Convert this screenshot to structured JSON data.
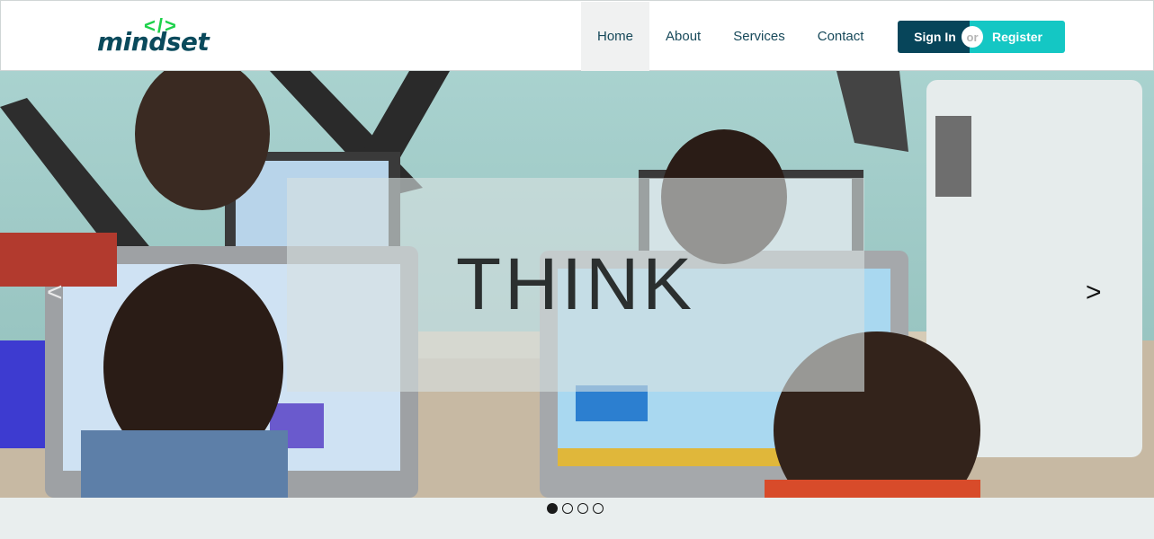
{
  "header": {
    "logo": {
      "code": "</>",
      "text": "mindset",
      "code_color": "#1dd14a",
      "text_color": "#0a4a5c"
    },
    "nav": [
      {
        "label": "Home",
        "active": true
      },
      {
        "label": "About",
        "active": false
      },
      {
        "label": "Services",
        "active": false
      },
      {
        "label": "Contact",
        "active": false
      }
    ],
    "auth": {
      "signin_label": "Sign In",
      "or_label": "or",
      "register_label": "Register",
      "signin_color": "#07455a",
      "register_color": "#14c7c4"
    }
  },
  "hero": {
    "caption": "THINK",
    "prev_label": "<",
    "next_label": ">",
    "slides_total": 4,
    "active_slide": 1
  }
}
